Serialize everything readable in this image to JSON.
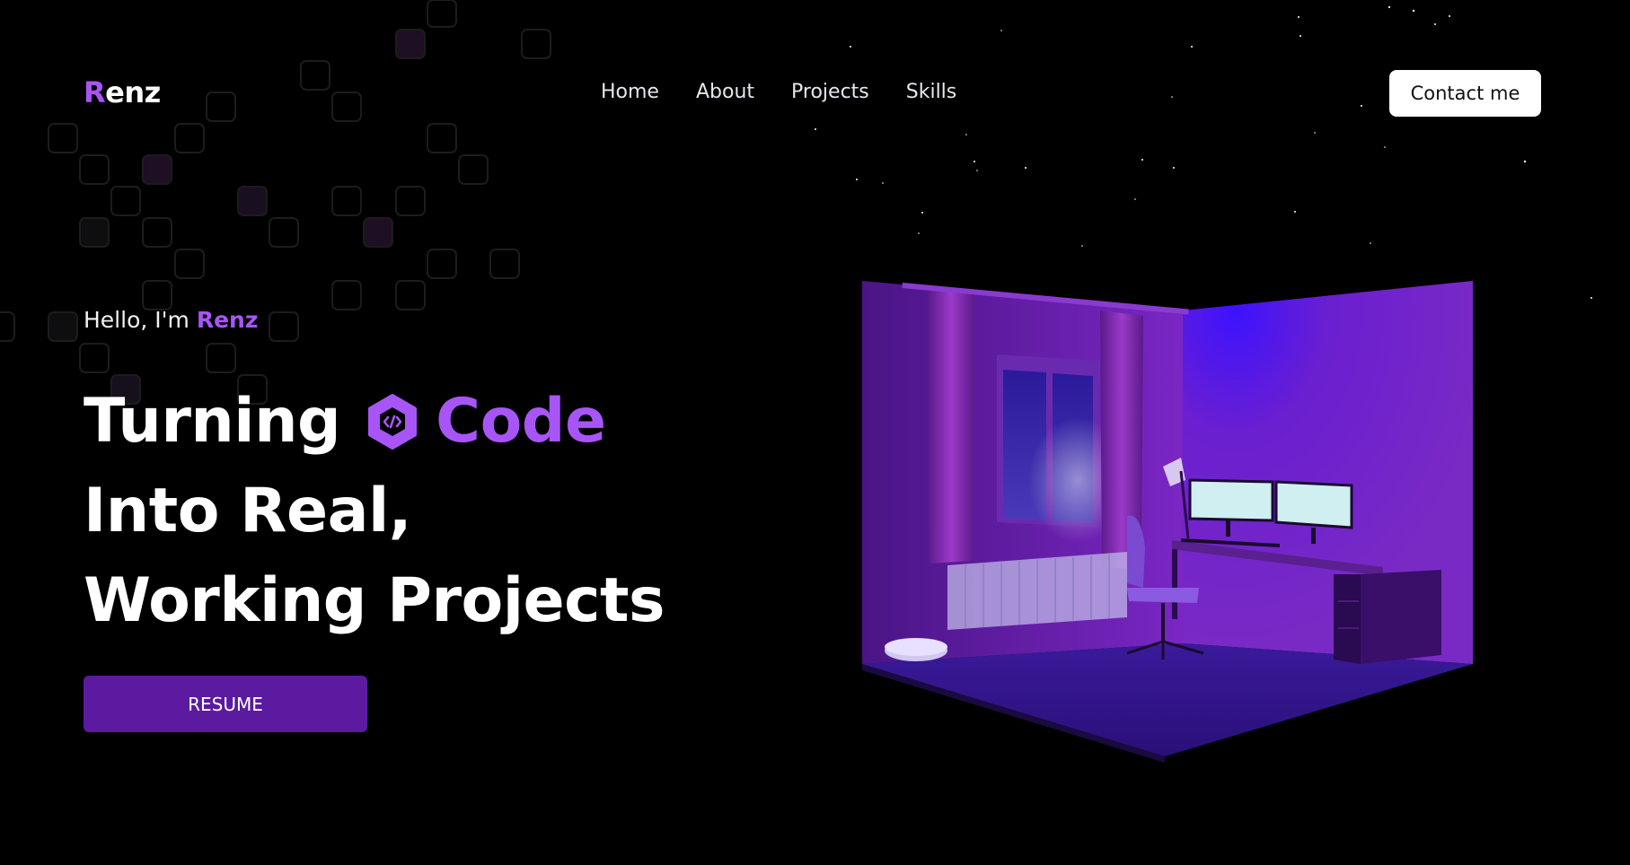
{
  "header": {
    "logo_first": "R",
    "logo_rest": "enz",
    "nav": [
      "Home",
      "About",
      "Projects",
      "Skills"
    ],
    "contact_label": "Contact me"
  },
  "hero": {
    "greeting_prefix": "Hello, I'm ",
    "greeting_name": "Renz",
    "headline_line1": "Turning",
    "headline_code": "Code",
    "headline_line2": "Into Real,",
    "headline_line3": "Working Projects",
    "resume_label": "RESUME"
  },
  "icons": {
    "code_badge": "hexagon-code-icon",
    "illustration": "isometric-room-illustration"
  },
  "colors": {
    "accent": "#a855f7",
    "button": "#5b1a9f",
    "background": "#000000",
    "room": "#6b1fc6"
  }
}
